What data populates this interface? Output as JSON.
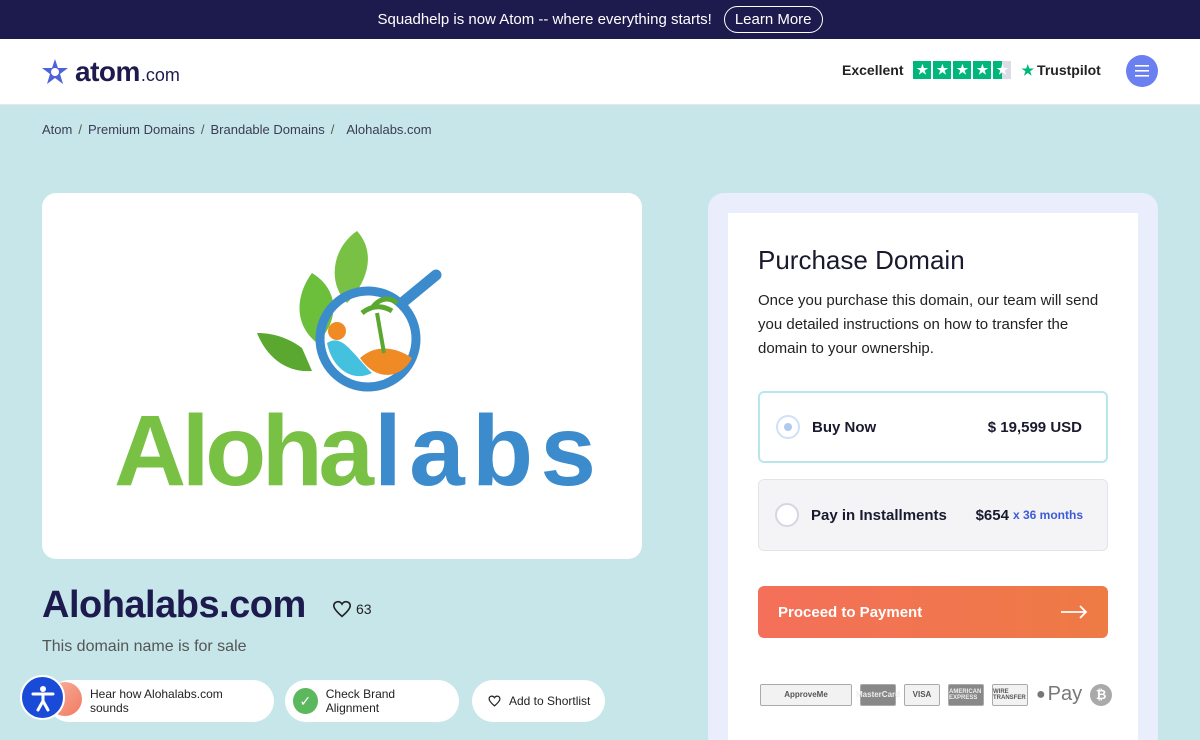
{
  "banner": {
    "text": "Squadhelp is now Atom -- where everything starts!",
    "cta": "Learn More"
  },
  "header": {
    "logo_word": "atom",
    "logo_suffix": ".com",
    "rating_label": "Excellent",
    "rating_stars": 4.5,
    "trustpilot": "Trustpilot",
    "menu_icon": "hamburger-icon"
  },
  "breadcrumb": [
    "Atom",
    "Premium Domains",
    "Brandable Domains",
    "Alohalabs.com"
  ],
  "logo_card": {
    "brand_part1": "Aloha",
    "brand_part2": "labs"
  },
  "domain": {
    "name": "Alohalabs.com",
    "likes": "63",
    "for_sale": "This domain name is for sale"
  },
  "actions": {
    "sound": "Hear how Alohalabs.com sounds",
    "brand": "Check Brand Alignment",
    "shortlist": "Add to Shortlist"
  },
  "purchase": {
    "title": "Purchase Domain",
    "description": "Once you purchase this domain, our team will send you detailed instructions on how to transfer the domain to your ownership.",
    "buy_label": "Buy Now",
    "buy_price": "$ 19,599 USD",
    "installment_label": "Pay in Installments",
    "installment_price": "$654",
    "installment_term": "x 36 months",
    "proceed": "Proceed to Payment"
  },
  "payment_methods": [
    "ApproveMe",
    "MasterCard",
    "VISA",
    "AMERICAN EXPRESS",
    "WIRE TRANSFER",
    "Pay",
    "bitcoin"
  ],
  "colors": {
    "brand_navy": "#1d1a4e",
    "accent_orange": "#f4705a",
    "page_bg": "#c6e6ea",
    "trustpilot_green": "#00b67a"
  }
}
